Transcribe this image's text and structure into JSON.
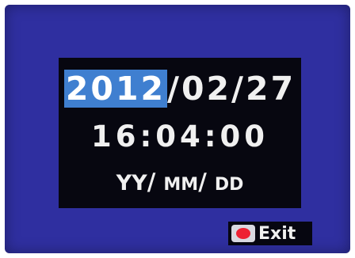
{
  "settings": {
    "date": {
      "year": "2012",
      "month_day": "/02/27"
    },
    "time": "16:04:00",
    "format": {
      "yy": "YY",
      "sep1": "/ ",
      "mm": "MM",
      "sep2": "/ ",
      "dd": "DD"
    }
  },
  "footer": {
    "key_icon": "record-button-icon",
    "exit_label": "Exit"
  },
  "colors": {
    "screen_background": "#2f2fa0",
    "panel_background": "#070710",
    "highlight": "#3f7fd0",
    "record_red": "#ee2233"
  }
}
